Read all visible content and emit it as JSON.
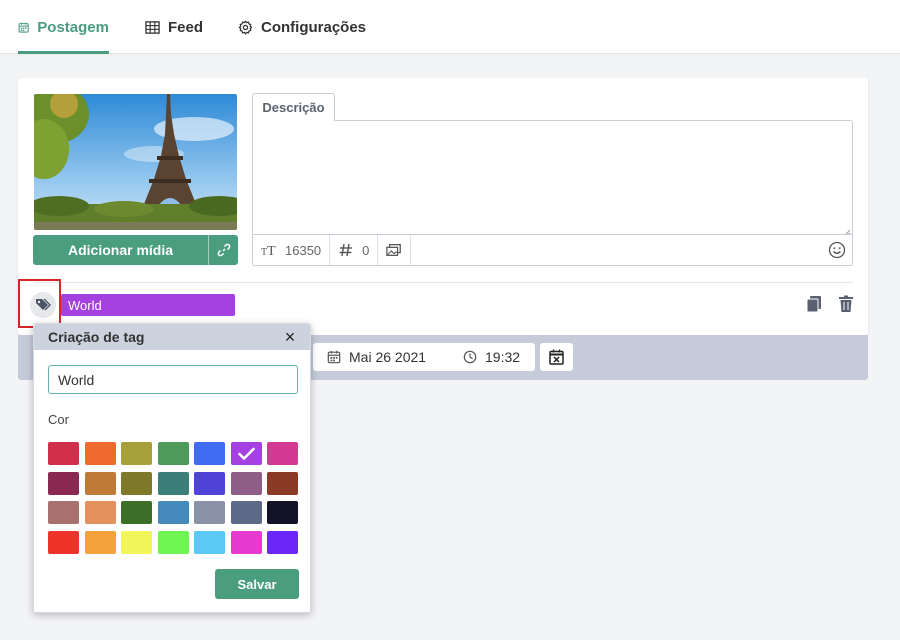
{
  "nav": {
    "tabs": [
      {
        "label": "Postagem",
        "icon": "calendar-icon",
        "active": true
      },
      {
        "label": "Feed",
        "icon": "grid-icon",
        "active": false
      },
      {
        "label": "Configurações",
        "icon": "gear-icon",
        "active": false
      }
    ]
  },
  "post": {
    "add_media_label": "Adicionar mídia",
    "description_tab": "Descrição",
    "description_value": "",
    "char_count": "16350",
    "hashtag_count": "0",
    "tag_label": "World",
    "tag_color": "#a541e0"
  },
  "schedule": {
    "date": "Mai 26 2021",
    "time": "19:32"
  },
  "tag_popup": {
    "title": "Criação de tag",
    "input_value": "World",
    "color_label": "Cor",
    "save_label": "Salvar",
    "selected_color_index": 5,
    "colors": [
      "#d0304a",
      "#ee6a2e",
      "#a5a03a",
      "#4e9a58",
      "#3f6cf2",
      "#a541e0",
      "#d43a94",
      "#8a2a52",
      "#bf7a35",
      "#7f7a2a",
      "#3b7f78",
      "#4f43d8",
      "#8f5f8a",
      "#8a3a25",
      "#a8716d",
      "#e2905c",
      "#3c6f27",
      "#448bbb",
      "#8a92a8",
      "#5c6987",
      "#121229",
      "#ee3428",
      "#f4a23c",
      "#f2f55a",
      "#6ff552",
      "#59c9f5",
      "#e63ad0",
      "#6a27f5"
    ]
  },
  "colors": {
    "accent": "#4a9d7f",
    "highlight": "#d6262b"
  }
}
